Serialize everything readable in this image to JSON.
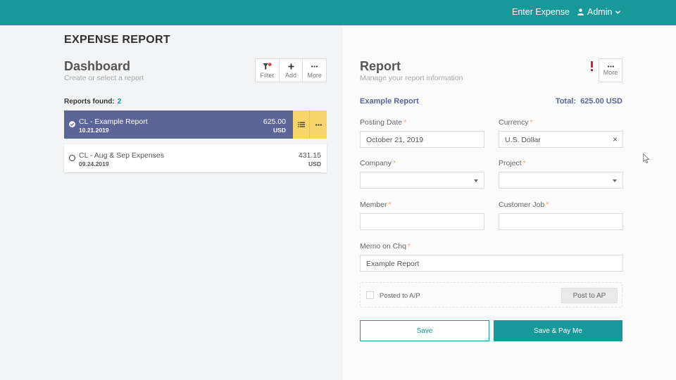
{
  "topbar": {
    "enter_expense": "Enter Expense",
    "admin_label": "Admin"
  },
  "app_title": "EXPENSE REPORT",
  "dashboard": {
    "title": "Dashboard",
    "subtitle": "Create or select a report",
    "toolbar": {
      "filter": "Filter",
      "add": "Add",
      "more": "More"
    },
    "reports_found_label": "Reports found:",
    "reports_found_count": "2",
    "reports": [
      {
        "name": "CL - Example Report",
        "date": "10.21.2019",
        "amount": "625.00",
        "currency": "USD",
        "selected": true
      },
      {
        "name": "CL - Aug & Sep Expenses",
        "date": "09.24.2019",
        "amount": "431.15",
        "currency": "USD",
        "selected": false
      }
    ]
  },
  "report": {
    "title": "Report",
    "subtitle": "Manage your report information",
    "more": "More",
    "name": "Example Report",
    "total_label": "Total:",
    "total_value": "625.00 USD",
    "fields": {
      "posting_date": {
        "label": "Posting Date",
        "value": "October 21, 2019"
      },
      "currency": {
        "label": "Currency",
        "value": "U.S. Dollar"
      },
      "company": {
        "label": "Company",
        "value": ""
      },
      "project": {
        "label": "Project",
        "value": ""
      },
      "member": {
        "label": "Member",
        "value": ""
      },
      "customer_job": {
        "label": "Customer Job",
        "value": ""
      },
      "memo": {
        "label": "Memo on Chq",
        "value": "Example Report"
      }
    },
    "required_mark": "*",
    "posted_label": "Posted to A/P",
    "post_button": "Post to AP",
    "save_button": "Save",
    "save_pay_button": "Save & Pay Me"
  },
  "colors": {
    "accent": "#17999a",
    "selected_card": "#5b6596",
    "card_actions": "#f7d56b",
    "required": "#f0a17a"
  },
  "icons": {
    "user": "user-icon",
    "dropdown": "chevron-down-icon",
    "filter": "filter-icon",
    "add": "plus-icon",
    "more": "ellipsis-icon",
    "list": "list-icon",
    "check": "check-circle-icon",
    "alert": "exclamation-icon",
    "clear": "close-icon"
  }
}
